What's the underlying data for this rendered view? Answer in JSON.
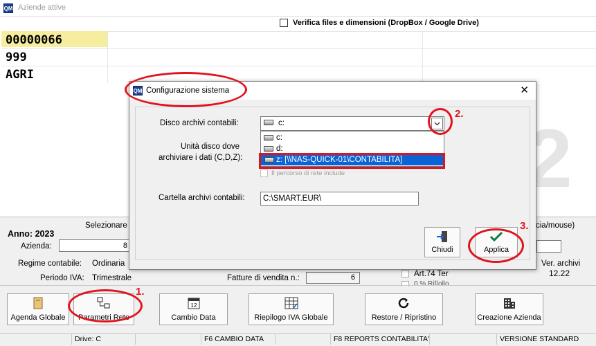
{
  "window": {
    "title": "Aziende attive"
  },
  "verify": {
    "label": "Verifica files e dimensioni (DropBox / Google Drive)",
    "checked": false
  },
  "company_list": [
    "00000066",
    "999",
    "AGRI"
  ],
  "company_info": {
    "seleziona_partial": "Selezionare",
    "mouse_partial": "cia/mouse)",
    "anno_label": "Anno: 2023",
    "azienda_label": "Azienda:",
    "azienda_partial": "8",
    "regime_label": "Regime contabile:",
    "regime_value": "Ordinaria",
    "periodo_label": "Periodo IVA:",
    "periodo_value": "Trimestrale",
    "fatture_label": "Fatture di vendita n.:",
    "fatture_value": "6",
    "art74_label": "Art.74 Ter",
    "art_partial": "0 % Rif/ollo",
    "ver_label": "Ver. archivi",
    "ver_value": "12.22"
  },
  "dialog": {
    "title": "Configurazione sistema",
    "disco_label": "Disco archivi contabili:",
    "selected_drive": "c:",
    "drive_options": [
      "c:",
      "d:",
      "z: [\\\\NAS-QUICK-01\\CONTABILITA]"
    ],
    "unita_label_line1": "Unità disco dove",
    "unita_label_line2": "archiviare i dati (C,D,Z):",
    "network_path_label": "Il percorso di rete include",
    "cartella_label": "Cartella archivi contabili:",
    "cartella_value": "C:\\SMART.EUR\\",
    "chiudi_label": "Chiudi",
    "applica_label": "Applica"
  },
  "toolbar": [
    {
      "label": "Agenda Globale",
      "icon": "agenda-icon"
    },
    {
      "label": "Parametri Rete",
      "icon": "network-icon"
    },
    {
      "label": "Cambio Data",
      "icon": "calendar-icon"
    },
    {
      "label": "Riepilogo IVA Globale",
      "icon": "grid-report-icon"
    },
    {
      "label": "Restore / Ripristino",
      "icon": "restore-icon"
    },
    {
      "label": "Creazione Azienda",
      "icon": "building-icon"
    }
  ],
  "status_bar": [
    "Drive: C",
    "F6 CAMBIO DATA",
    "F8 REPORTS CONTABILITA'",
    "VERSIONE STANDARD"
  ],
  "annotations": [
    "1.",
    "2.",
    "3."
  ],
  "colors": {
    "accent_red": "#e0141e",
    "highlight_yellow": "#f6ed9e",
    "selection_blue": "#0a64d6",
    "logo_blue": "#1a3d8f",
    "applica_check": "#0f7a3b"
  }
}
